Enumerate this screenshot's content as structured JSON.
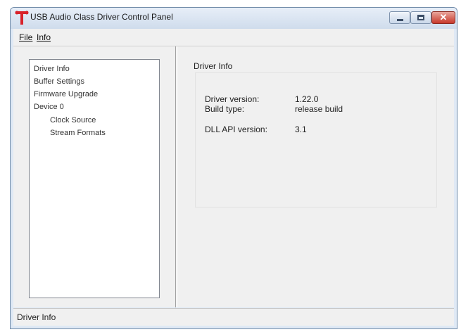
{
  "window": {
    "title": "USB Audio Class Driver Control Panel",
    "controls": {
      "minimize": "minimize-icon",
      "maximize": "maximize-icon",
      "close": "close-icon"
    }
  },
  "menu": {
    "file": "File",
    "info": "Info"
  },
  "tree": {
    "items": [
      {
        "label": "Driver Info"
      },
      {
        "label": "Buffer Settings"
      },
      {
        "label": "Firmware Upgrade"
      },
      {
        "label": "Device 0"
      },
      {
        "label": "Clock Source"
      },
      {
        "label": "Stream Formats"
      }
    ]
  },
  "panel": {
    "title": "Driver Info",
    "rows": [
      {
        "label": "Driver version:",
        "value": "1.22.0"
      },
      {
        "label": "Build type:",
        "value": "release build"
      },
      {
        "label": "DLL API version:",
        "value": "3.1"
      }
    ]
  },
  "status": {
    "text": "Driver Info"
  },
  "colors": {
    "accent": "#d8222a",
    "title_bar": "#dfe9f5",
    "close_button": "#c8392b"
  }
}
